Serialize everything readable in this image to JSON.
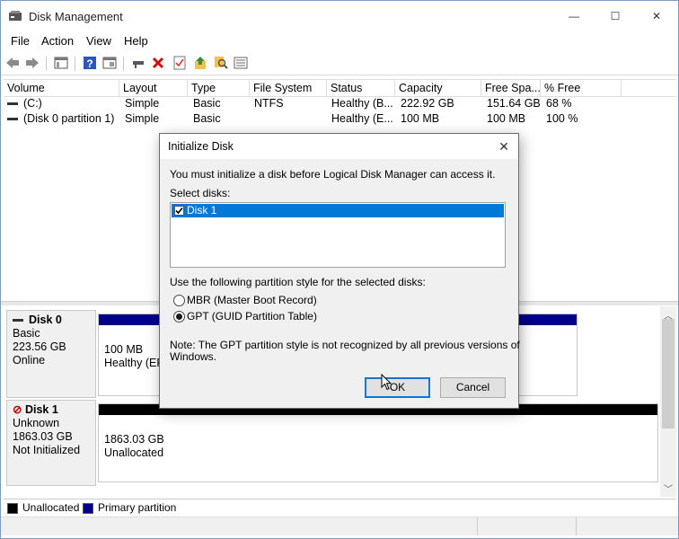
{
  "window": {
    "title": "Disk Management",
    "controls": [
      "—",
      "☐",
      "✕"
    ]
  },
  "menu": [
    "File",
    "Action",
    "View",
    "Help"
  ],
  "toolbar_icons": [
    "back-icon",
    "forward-icon",
    "console-tree-icon",
    "help-icon",
    "view-icon",
    "connect-icon",
    "delete-icon",
    "properties-icon",
    "refresh-icon",
    "search-icon",
    "list-icon"
  ],
  "columns": [
    "Volume",
    "Layout",
    "Type",
    "File System",
    "Status",
    "Capacity",
    "Free Spa...",
    "% Free"
  ],
  "volumes": [
    {
      "volume": "(C:)",
      "layout": "Simple",
      "type": "Basic",
      "fs": "NTFS",
      "status": "Healthy (B...",
      "capacity": "222.92 GB",
      "free": "151.64 GB",
      "pct": "68 %"
    },
    {
      "volume": "(Disk 0 partition 1)",
      "layout": "Simple",
      "type": "Basic",
      "fs": "",
      "status": "Healthy (E...",
      "capacity": "100 MB",
      "free": "100 MB",
      "pct": "100 %"
    }
  ],
  "disks": [
    {
      "name": "Disk 0",
      "type": "Basic",
      "size": "223.56 GB",
      "state": "Online",
      "part_size": "100 MB",
      "part_status": "Healthy (EFI"
    },
    {
      "name": "Disk 1",
      "type": "Unknown",
      "size": "1863.03 GB",
      "state": "Not Initialized",
      "part_size": "1863.03 GB",
      "part_status": "Unallocated"
    }
  ],
  "legend": [
    {
      "label": "Unallocated",
      "color": "#000000"
    },
    {
      "label": "Primary partition",
      "color": "#00008b"
    }
  ],
  "dialog": {
    "title": "Initialize Disk",
    "intro": "You must initialize a disk before Logical Disk Manager can access it.",
    "select_label": "Select disks:",
    "disk_item": "Disk 1",
    "disk_checked": true,
    "style_label": "Use the following partition style for the selected disks:",
    "mbr_label": "MBR (Master Boot Record)",
    "gpt_label": "GPT (GUID Partition Table)",
    "selected_style": "GPT",
    "note_line1": "Note: The GPT partition style is not recognized by all previous versions of",
    "note_line2": "Windows.",
    "ok_label": "OK",
    "cancel_label": "Cancel"
  },
  "colors": {
    "selection": "#0078d7",
    "primary_partition": "#00008b",
    "unallocated": "#000000"
  }
}
